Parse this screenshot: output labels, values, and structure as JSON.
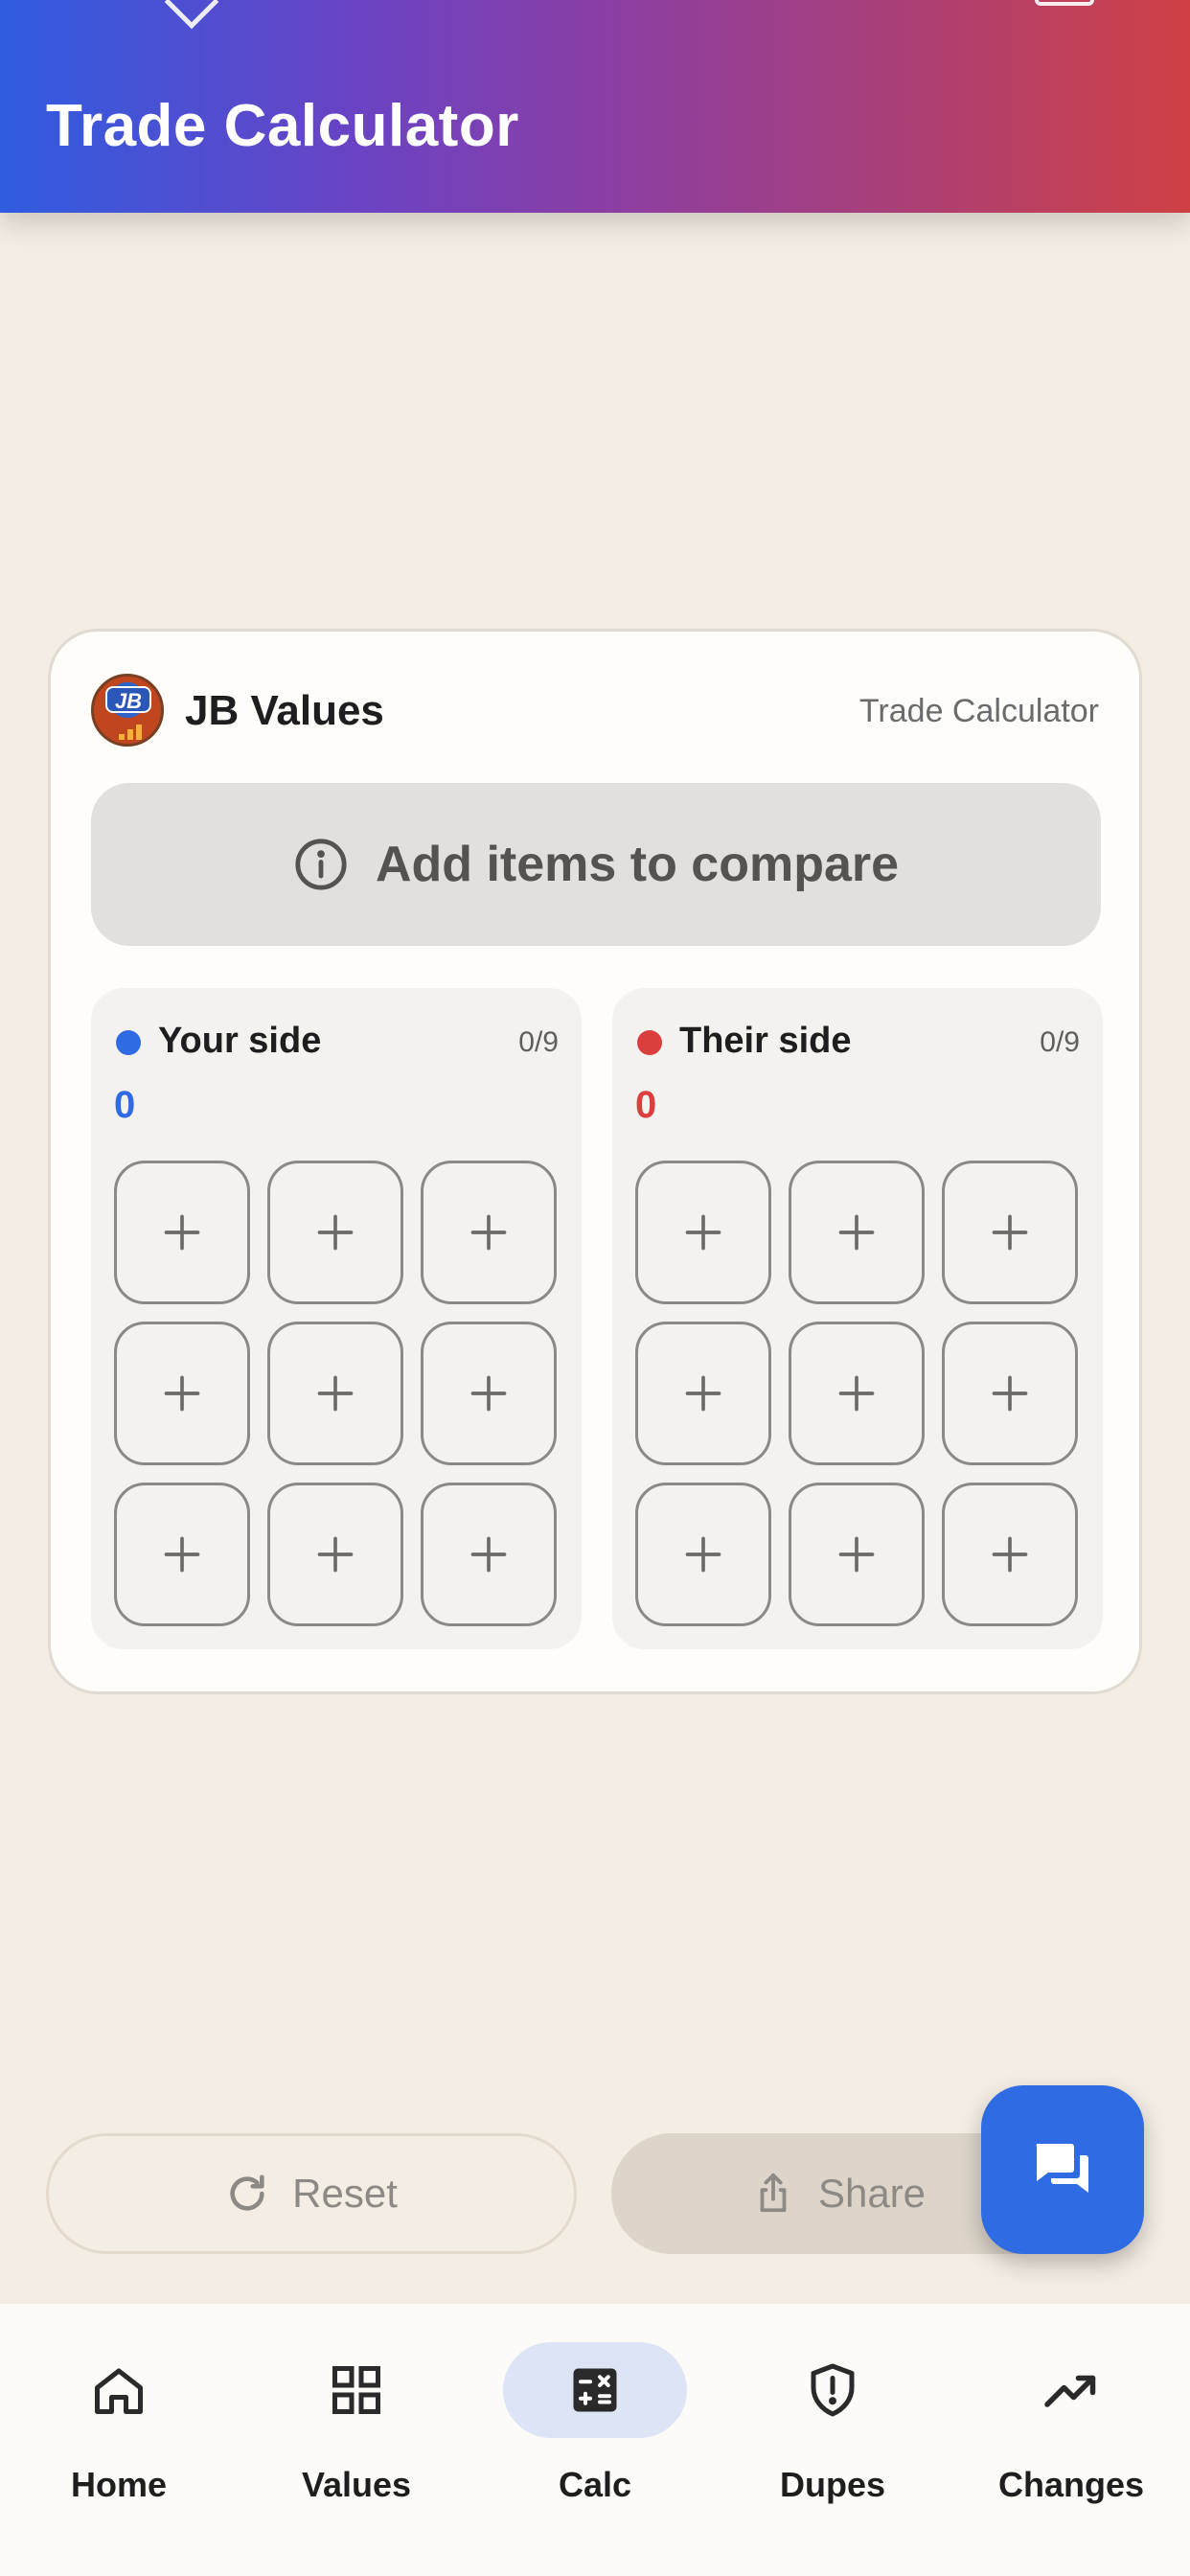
{
  "header": {
    "title": "Trade Calculator"
  },
  "card": {
    "brand_name": "JB Values",
    "logo_text": "JB",
    "subtitle": "Trade Calculator",
    "compare_message": "Add items to compare"
  },
  "your_side": {
    "label": "Your side",
    "count": "0/9",
    "total": "0",
    "color": "#2f6be3"
  },
  "their_side": {
    "label": "Their side",
    "count": "0/9",
    "total": "0",
    "color": "#dc3e3e"
  },
  "actions": {
    "reset_label": "Reset",
    "share_label": "Share"
  },
  "nav": {
    "items": [
      {
        "label": "Home",
        "icon": "home-icon"
      },
      {
        "label": "Values",
        "icon": "grid-icon"
      },
      {
        "label": "Calc",
        "icon": "calculator-icon"
      },
      {
        "label": "Dupes",
        "icon": "shield-alert-icon"
      },
      {
        "label": "Changes",
        "icon": "trending-up-icon"
      }
    ],
    "active": "Calc"
  },
  "colors": {
    "accent": "#2f6be3",
    "background": "#f4ede3"
  }
}
